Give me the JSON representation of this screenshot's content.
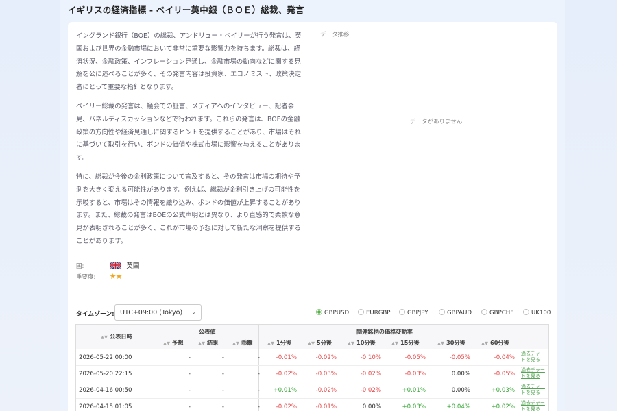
{
  "page": {
    "title": "イギリスの経済指標 - ベイリー英中銀（ＢＯＥ）総裁、発言"
  },
  "description": {
    "paragraphs": [
      "イングランド銀行（BOE）の総裁、アンドリュー・ベイリーが行う発言は、英国および世界の金融市場において非常に重要な影響力を持ちます。総裁は、経済状況、金融政策、インフレーション見通し、金融市場の動向などに関する見解を公に述べることが多く、その発言内容は投資家、エコノミスト、政策決定者にとって重要な指針となります。",
      "ベイリー総裁の発言は、議会での証言、メディアへのインタビュー、記者会見、パネルディスカッションなどで行われます。これらの発言は、BOEの金融政策の方向性や経済見通しに関するヒントを提供することがあり、市場はそれに基づいて取引を行い、ポンドの価値や株式市場に影響を与えることがあります。",
      "特に、総裁が今後の金利政策について言及すると、その発言は市場の期待や予測を大きく変える可能性があります。例えば、総裁が金利引き上げの可能性を示唆すると、市場はその情報を織り込み、ポンドの価値が上昇することがあります。また、総裁の発言はBOEの公式声明とは異なり、より直感的で柔軟な意見が表明されることが多く、これが市場の予想に対して新たな洞察を提供することがあります。"
    ]
  },
  "meta": {
    "country_label": "国:",
    "country_value": "英国",
    "importance_label": "重要度:",
    "importance_stars": "★★"
  },
  "chart": {
    "label": "データ推移",
    "empty_text": "データがありません"
  },
  "controls": {
    "timezone_label": "タイムゾーン:",
    "timezone_value": "UTC+09:00 (Tokyo)",
    "symbols": [
      {
        "label": "GBPUSD",
        "selected": true
      },
      {
        "label": "EURGBP",
        "selected": false
      },
      {
        "label": "GBPJPY",
        "selected": false
      },
      {
        "label": "GBPAUD",
        "selected": false
      },
      {
        "label": "GBPCHF",
        "selected": false
      },
      {
        "label": "UK100",
        "selected": false
      }
    ]
  },
  "table": {
    "headers": {
      "date": "公表日時",
      "group_actual": "公表値",
      "forecast": "予想",
      "result": "結果",
      "deviation": "乖離",
      "group_change": "関連銘柄の価格変動率",
      "m1": "1分後",
      "m5": "5分後",
      "m10": "10分後",
      "m15": "15分後",
      "m30": "30分後",
      "m60": "60分後"
    },
    "rows": [
      {
        "date": "2026-05-22 00:00",
        "forecast": "-",
        "result": "-",
        "deviation": "-",
        "m1": "-0.01%",
        "m5": "-0.02%",
        "m10": "-0.10%",
        "m15": "-0.05%",
        "m30": "-0.05%",
        "m60": "-0.04%",
        "link": "過去チャートを見る"
      },
      {
        "date": "2026-05-20 22:15",
        "forecast": "-",
        "result": "-",
        "deviation": "-",
        "m1": "-0.02%",
        "m5": "-0.03%",
        "m10": "-0.02%",
        "m15": "-0.03%",
        "m30": "0.00%",
        "m60": "-0.05%",
        "link": "過去チャートを見る"
      },
      {
        "date": "2026-04-16 00:50",
        "forecast": "-",
        "result": "-",
        "deviation": "-",
        "m1": "+0.01%",
        "m5": "-0.02%",
        "m10": "-0.02%",
        "m15": "+0.01%",
        "m30": "0.00%",
        "m60": "+0.03%",
        "link": "過去チャートを見る"
      },
      {
        "date": "2026-04-15 01:05",
        "forecast": "-",
        "result": "-",
        "deviation": "-",
        "m1": "-0.02%",
        "m5": "-0.01%",
        "m10": "0.00%",
        "m15": "+0.03%",
        "m30": "+0.04%",
        "m60": "+0.02%",
        "link": "過去チャートを見る"
      }
    ]
  },
  "colors": {
    "negative": "#e54a4a",
    "positive": "#3aa63a",
    "accent": "#55b046",
    "star": "#f0a520"
  }
}
